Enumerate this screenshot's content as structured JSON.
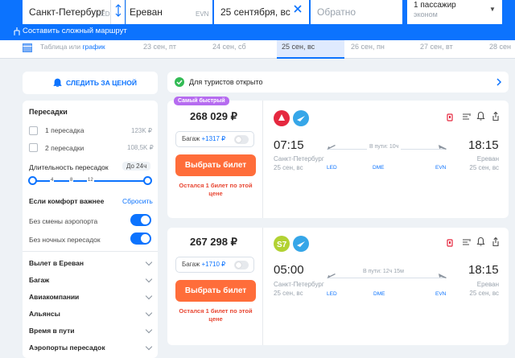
{
  "search": {
    "origin": "Санкт-Петербург",
    "origin_code": "LED",
    "destination": "Ереван",
    "destination_code": "EVN",
    "date": "25 сентября, вс",
    "return_placeholder": "Обратно",
    "passengers": "1 пассажир",
    "cabin": "эконом",
    "complex_route": "Составить сложный маршрут"
  },
  "dates": {
    "table_label": "Таблица или",
    "graph_link": "график",
    "items": [
      "23 сен, пт",
      "24 сен, сб",
      "25 сен, вс",
      "26 сен, пн",
      "27 сен, вт",
      "28 сен"
    ]
  },
  "sidebar": {
    "track_price": "СЛЕДИТЬ ЗА ЦЕНОЙ",
    "transfers_title": "Пересадки",
    "transfer1": "1 пересадка",
    "transfer1_price": "123K ₽",
    "transfer2": "2 пересадки",
    "transfer2_price": "108,5K ₽",
    "duration_title": "Длительность пересадок",
    "duration_value": "До 24ч",
    "slider_ticks": [
      "4",
      "8",
      "12"
    ],
    "comfort_title": "Если комфорт важнее",
    "reset": "Сбросить",
    "no_airport_change": "Без смены аэропорта",
    "no_night": "Без ночных пересадок",
    "accordions": [
      "Вылет в Ереван",
      "Багаж",
      "Авиакомпании",
      "Альянсы",
      "Время в пути",
      "Аэропорты пересадок"
    ]
  },
  "banner": {
    "text": "Для туристов открыто"
  },
  "tickets": [
    {
      "badge": "Самый быстрый",
      "price": "268 029 ₽",
      "baggage": "Багаж",
      "baggage_extra": "+1317 ₽",
      "buy": "Выбрать билет",
      "note": "Остался 1 билет по этой цене",
      "dep_time": "07:15",
      "arr_time": "18:15",
      "dep_city": "Санкт-Петербург",
      "dep_date": "25 сен, вс",
      "arr_city": "Ереван",
      "arr_date": "25 сен, вс",
      "duration": "В пути: 10ч",
      "codes": [
        "LED",
        "DME",
        "EVN"
      ]
    },
    {
      "price": "267 298 ₽",
      "baggage": "Багаж",
      "baggage_extra": "+1710 ₽",
      "buy": "Выбрать билет",
      "note": "Остался 1 билет по этой цене",
      "dep_time": "05:00",
      "arr_time": "18:15",
      "dep_city": "Санкт-Петербург",
      "dep_date": "25 сен, вс",
      "arr_city": "Ереван",
      "arr_date": "25 сен, вс",
      "duration": "В пути: 12ч 15м",
      "codes": [
        "LED",
        "DME",
        "EVN"
      ]
    }
  ],
  "colors": {
    "accent": "#0c73fe",
    "buy": "#ff6d3a",
    "badge": "#b66cf0"
  }
}
